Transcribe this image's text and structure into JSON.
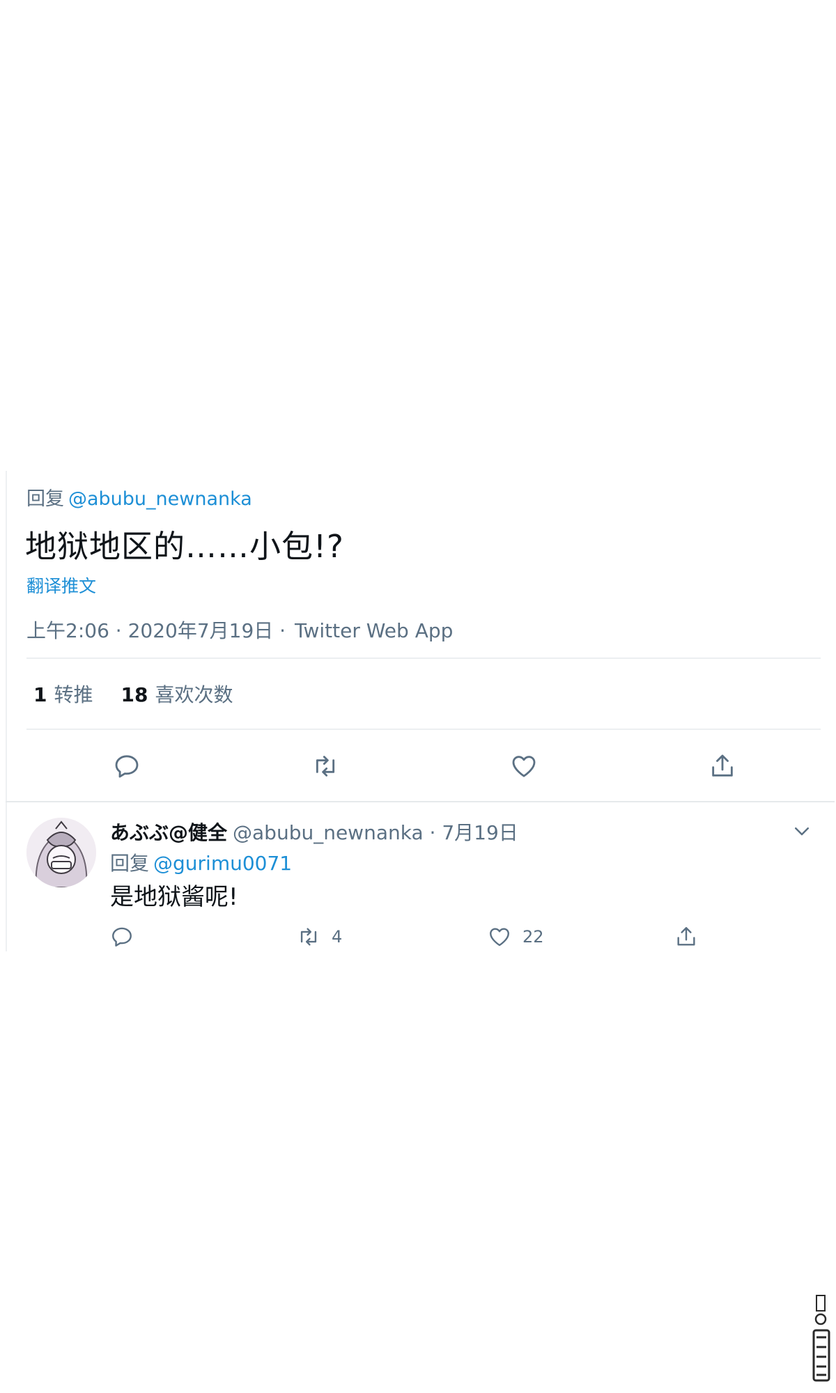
{
  "main_tweet": {
    "reply_label": "回复",
    "reply_handle": "@abubu_newnanka",
    "text": "地狱地区的……小包!?",
    "translate": "翻译推文",
    "timestamp": "上午2:06 · 2020年7月19日 ·",
    "source": "Twitter Web App",
    "retweets_count": "1",
    "retweets_label": "转推",
    "likes_count": "18",
    "likes_label": "喜欢次数",
    "actions": [
      "reply-icon",
      "retweet-icon",
      "heart-icon",
      "share-icon"
    ]
  },
  "reply_tweet": {
    "name": "あぶぶ@健全",
    "handle": "@abubu_newnanka · 7月19日",
    "reply_label": "回复",
    "reply_handle": "@gurimu0071",
    "text": "是地狱酱呢!",
    "retweets_count": "4",
    "likes_count": "22",
    "actions": [
      "reply-icon",
      "retweet-icon",
      "heart-icon",
      "share-icon",
      "chevron-down-icon"
    ]
  },
  "colors": {
    "text": "#0f1419",
    "secondary": "#5b7083",
    "link": "#1d8fd6",
    "divider": "#eceff1"
  }
}
